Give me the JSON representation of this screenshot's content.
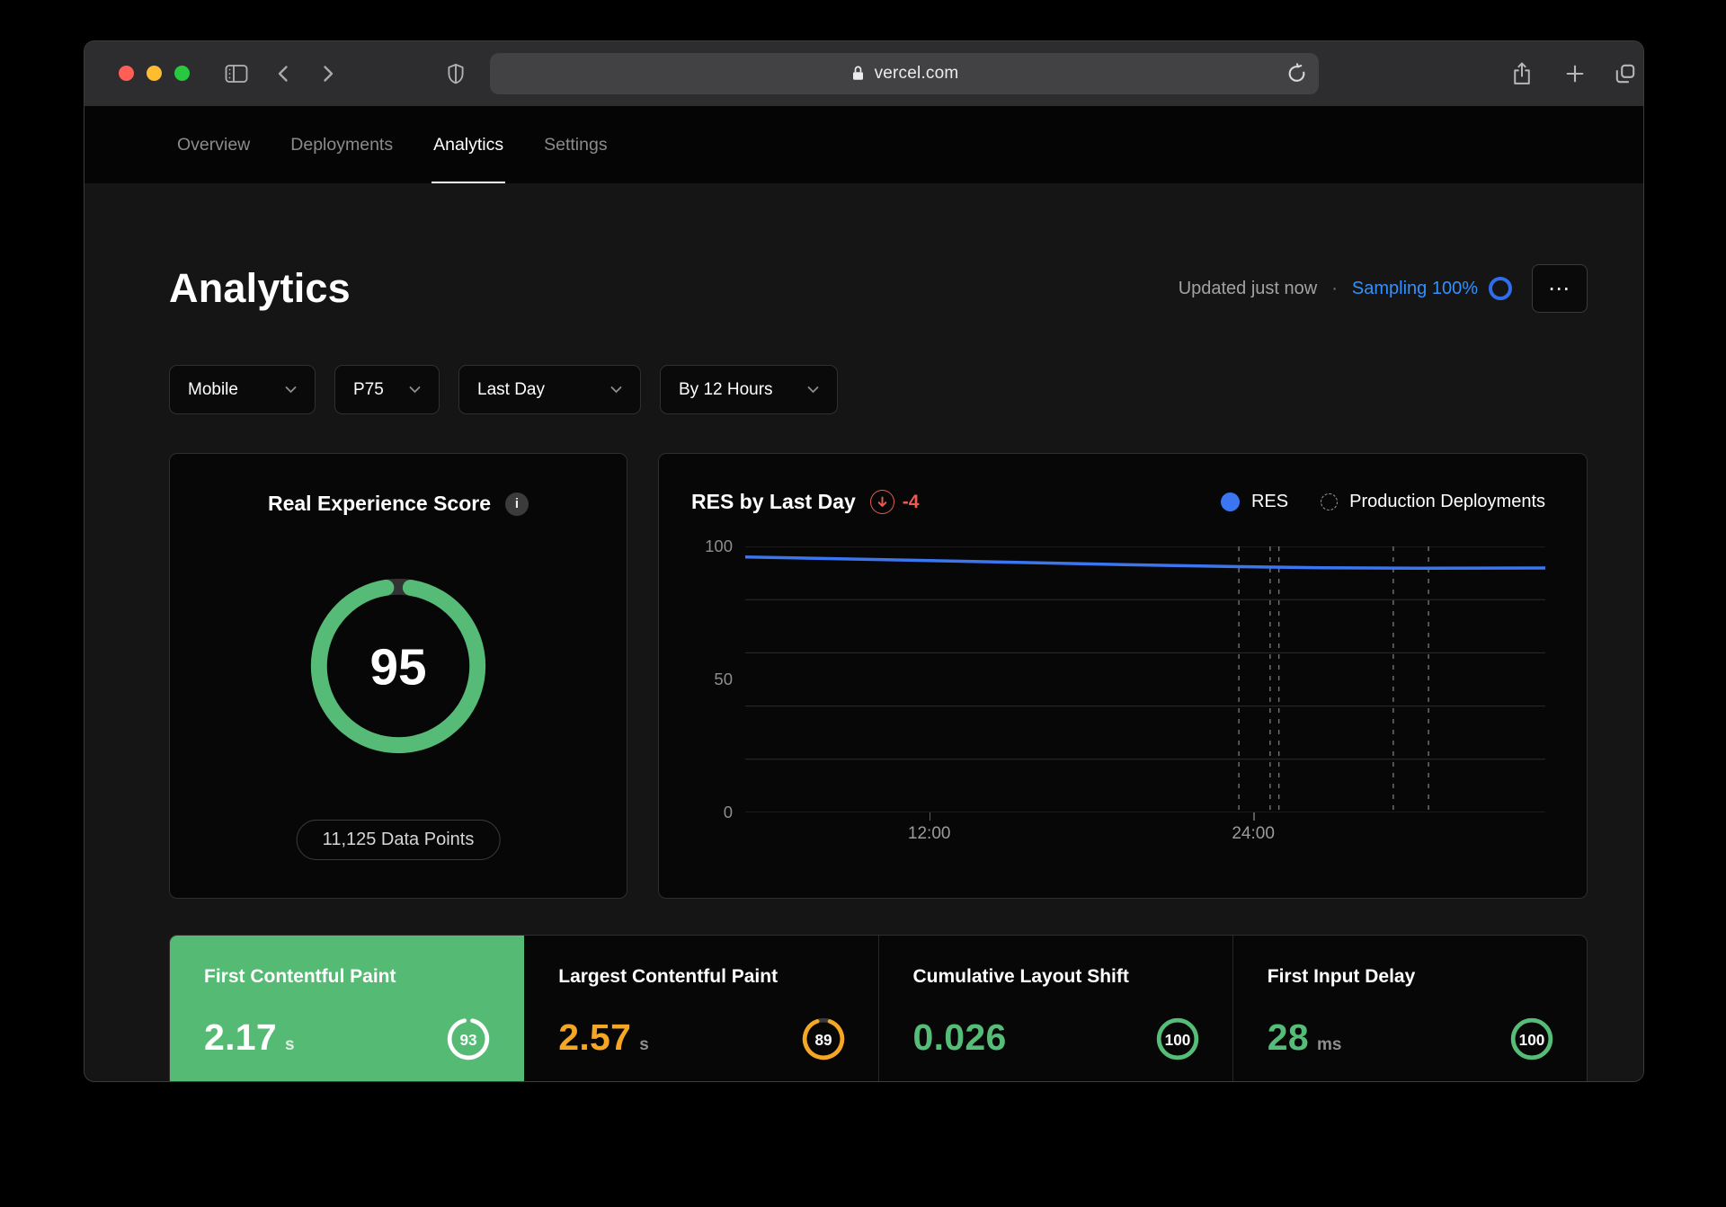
{
  "browser": {
    "url": "vercel.com",
    "traffic_light_colors": [
      "#ff5f57",
      "#febc2e",
      "#28c840"
    ]
  },
  "nav": {
    "tabs": [
      {
        "label": "Overview",
        "active": false
      },
      {
        "label": "Deployments",
        "active": false
      },
      {
        "label": "Analytics",
        "active": true
      },
      {
        "label": "Settings",
        "active": false
      }
    ]
  },
  "page": {
    "title": "Analytics",
    "updated": "Updated just now",
    "separator": "·",
    "sampling_label": "Sampling 100%",
    "sampling_color": "#3291ff",
    "more_label": "⋯"
  },
  "filters": [
    {
      "label": "Mobile"
    },
    {
      "label": "P75"
    },
    {
      "label": "Last Day"
    },
    {
      "label": "By 12 Hours"
    }
  ],
  "res_card": {
    "title": "Real Experience Score",
    "info_glyph": "i",
    "score": "95",
    "ring_color": "#55bb76",
    "track_color": "#333333",
    "data_points": "11,125 Data Points"
  },
  "chart": {
    "title": "RES by Last Day",
    "delta": "-4",
    "delta_color": "#ec5a4f",
    "legend": [
      {
        "label": "RES"
      },
      {
        "label": "Production Deployments"
      }
    ]
  },
  "chart_data": {
    "type": "line",
    "title": "RES by Last Day",
    "delta": -4,
    "ylim": [
      0,
      100
    ],
    "y_gridlines": [
      0,
      20,
      40,
      60,
      80,
      100
    ],
    "y_tick_labels": [
      "100",
      "50",
      "0"
    ],
    "x_ticks": [
      {
        "label": "12:00",
        "frac": 0.23
      },
      {
        "label": "24:00",
        "frac": 0.635
      }
    ],
    "series": [
      {
        "name": "RES",
        "x_frac": [
          0,
          0.11,
          0.23,
          0.36,
          0.48,
          0.617,
          0.72,
          0.84,
          1.0
        ],
        "values": [
          96,
          95.4,
          94.7,
          93.9,
          93.1,
          92.4,
          92.0,
          91.8,
          91.9
        ]
      }
    ],
    "deployment_lines_frac": [
      0.617,
      0.656,
      0.667,
      0.81,
      0.854
    ],
    "legend_entries": [
      "RES",
      "Production Deployments"
    ],
    "legend_position": "top-right",
    "line_color": "#3b76f0",
    "grid_color": "#2c2c2c",
    "deployment_line_color": "#8a8a8a"
  },
  "metrics": [
    {
      "title": "First Contentful Paint",
      "value": "2.17",
      "unit": "s",
      "score": "93",
      "bg": "#55ba73",
      "value_color": "#ffffff",
      "unit_color": "rgba(255,255,255,0.8)",
      "ring_color": "#ffffff",
      "track_color": "rgba(255,255,255,0)"
    },
    {
      "title": "Largest Contentful Paint",
      "value": "2.57",
      "unit": "s",
      "score": "89",
      "bg": "#070707",
      "value_color": "#f5a623",
      "unit_color": "#8f8f8f",
      "ring_color": "#f5a623",
      "track_color": "#3a3a3a"
    },
    {
      "title": "Cumulative Layout Shift",
      "value": "0.026",
      "unit": "",
      "score": "100",
      "bg": "#070707",
      "value_color": "#56bd78",
      "unit_color": "#8f8f8f",
      "ring_color": "#56bd78",
      "track_color": "#3a3a3a"
    },
    {
      "title": "First Input Delay",
      "value": "28",
      "unit": "ms",
      "score": "100",
      "bg": "#070707",
      "value_color": "#56bd78",
      "unit_color": "#8f8f8f",
      "ring_color": "#56bd78",
      "track_color": "#3a3a3a"
    }
  ]
}
